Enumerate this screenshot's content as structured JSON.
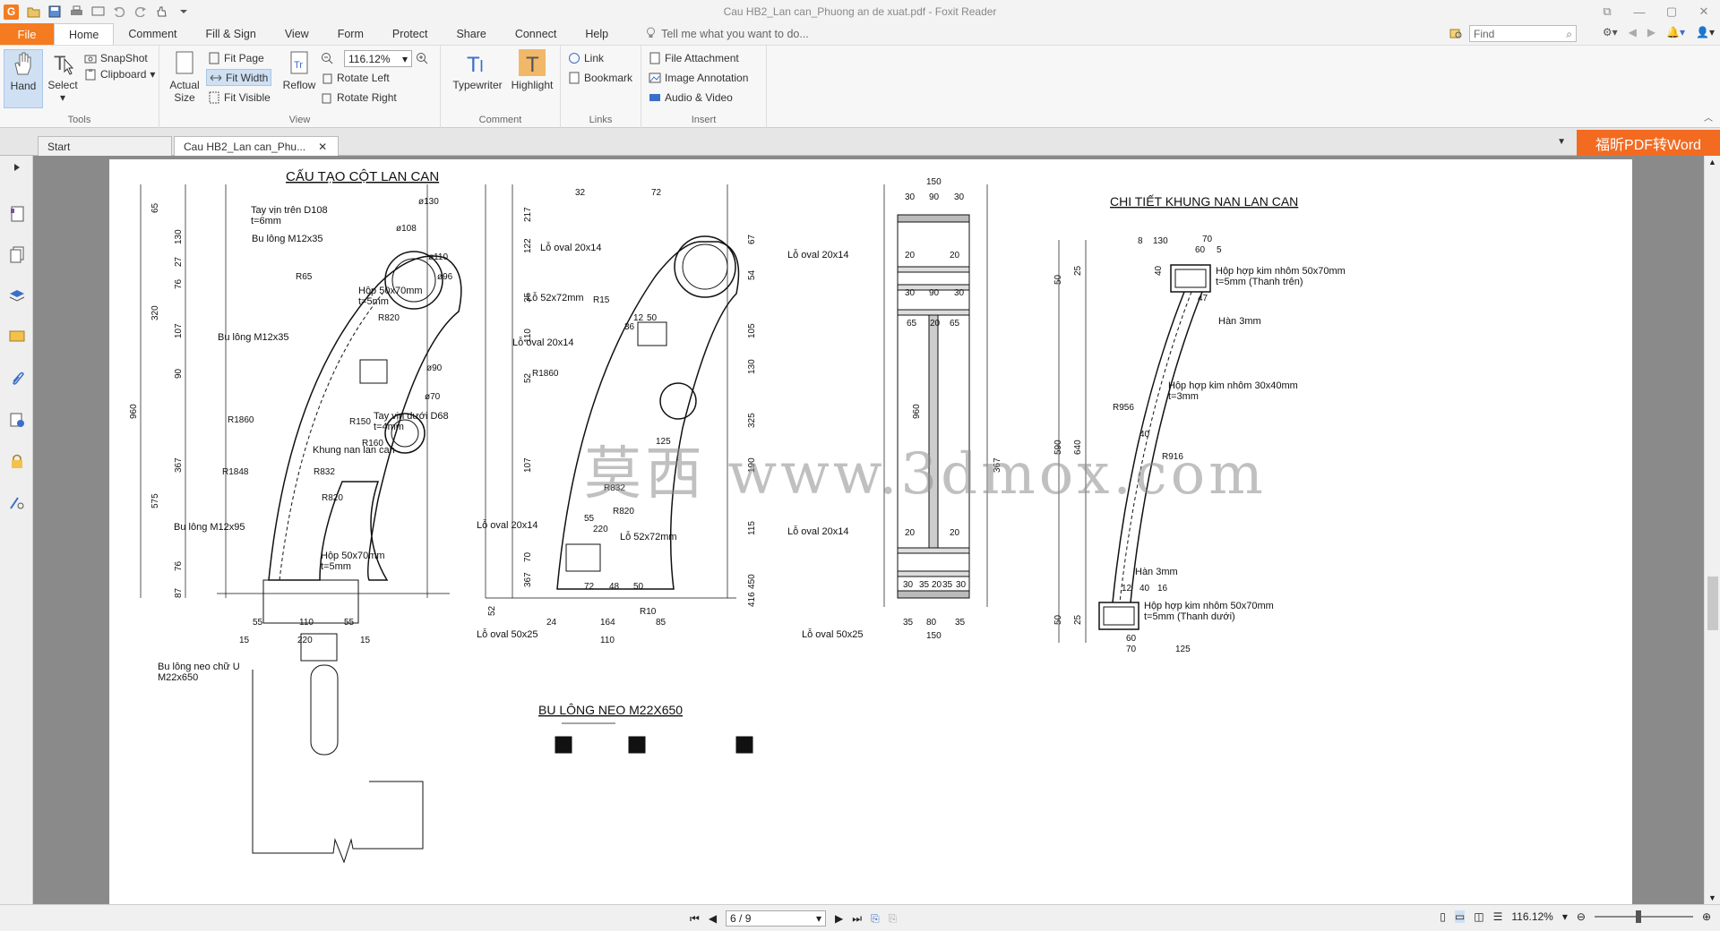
{
  "window": {
    "title": "Cau HB2_Lan can_Phuong an de xuat.pdf - Foxit Reader",
    "app_icon": "G",
    "buttons": [
      "restore-icon",
      "minimize-icon",
      "maximize-icon",
      "close-icon"
    ]
  },
  "menu": {
    "file": "File",
    "items": [
      "Home",
      "Comment",
      "Fill & Sign",
      "View",
      "Form",
      "Protect",
      "Share",
      "Connect",
      "Help"
    ],
    "active": "Home",
    "tell_me": "Tell me what you want to do...",
    "find_placeholder": "Find"
  },
  "ribbon": {
    "tools": {
      "label": "Tools",
      "hand": "Hand",
      "select": "Select",
      "snapshot": "SnapShot",
      "clipboard": "Clipboard"
    },
    "view": {
      "label": "View",
      "actual_size_1": "Actual",
      "actual_size_2": "Size",
      "fit_page": "Fit Page",
      "fit_width": "Fit Width",
      "fit_visible": "Fit Visible",
      "reflow": "Reflow",
      "zoom": "116.12%",
      "rotate_left": "Rotate Left",
      "rotate_right": "Rotate Right"
    },
    "comment": {
      "label": "Comment",
      "typewriter": "Typewriter",
      "highlight": "Highlight"
    },
    "links": {
      "label": "Links",
      "link": "Link",
      "bookmark": "Bookmark"
    },
    "insert": {
      "label": "Insert",
      "file_attachment": "File Attachment",
      "image_annotation": "Image Annotation",
      "audio_video": "Audio & Video"
    }
  },
  "tabs": {
    "start": "Start",
    "doc": "Cau HB2_Lan can_Phu...",
    "promo": "福昕PDF转Word"
  },
  "drawing": {
    "title_left": "CẤU TẠO CỘT LAN CAN",
    "title_right": "CHI TIẾT KHUNG NAN LAN CAN",
    "title_bottom": "BU LÔNG NEO M22X650",
    "labels": {
      "tay_vin_tren": "Tay vịn trên D108",
      "t6": "t=6mm",
      "bu_long_1": "Bu lông M12x35",
      "bu_long_2": "Bu lông M12x35",
      "hop_1": "Hộp 50x70mm",
      "t5": "t=5mm",
      "tay_vin_duoi": "Tay vịn dưới D68",
      "t4": "t=4mm",
      "khung": "Khung nan lan can",
      "bu_long_95": "Bu lông M12x95",
      "hop_2": "Hộp 50x70mm",
      "t5b": "t=5mm",
      "bu_long_neo": "Bu lông neo chữ U",
      "m22": "M22x650",
      "lo_oval_1": "Lỗ oval 20x14",
      "lo_52": "Lỗ 52x72mm",
      "lo_oval_2": "Lỗ oval 20x14",
      "lo_oval_3": "Lỗ oval 20x14",
      "lo_52b": "Lỗ 52x72mm",
      "lo_oval_50": "Lỗ oval 50x25",
      "lo_oval_4": "Lỗ oval 20x14",
      "lo_oval_5": "Lỗ oval 20x14",
      "lo_oval_50b": "Lỗ oval 50x25",
      "hop_top": "Hộp hợp kim nhôm 50x70mm",
      "top_t": "t=5mm (Thanh trên)",
      "han_1": "Hàn 3mm",
      "hop_mid": "Hộp hợp kim nhôm 30x40mm",
      "mid_t": "t=3mm",
      "han_2": "Hàn 3mm",
      "hop_bot": "Hộp hợp kim nhôm 50x70mm",
      "bot_t": "t=5mm (Thanh dưới)"
    },
    "dims_left": [
      "65",
      "130",
      "27",
      "76",
      "320",
      "107",
      "90",
      "960",
      "575",
      "367",
      "76",
      "87",
      "55",
      "110",
      "55",
      "220",
      "15",
      "15"
    ],
    "dims_mid": [
      "217",
      "122",
      "35",
      "110",
      "52",
      "107",
      "70",
      "367",
      "52",
      "67",
      "54",
      "105",
      "130",
      "325",
      "190",
      "115",
      "450",
      "416",
      "125",
      "24",
      "164",
      "85",
      "110",
      "55",
      "220",
      "72",
      "48",
      "50",
      "12",
      "50",
      "36",
      "32",
      "72"
    ],
    "dims_col3": [
      "150",
      "30",
      "90",
      "30",
      "20",
      "20",
      "30",
      "90",
      "30",
      "65",
      "20",
      "65",
      "960",
      "367",
      "20",
      "20",
      "30",
      "35",
      "20",
      "35",
      "30",
      "35",
      "80",
      "35",
      "150"
    ],
    "dims_right": [
      "8",
      "130",
      "70",
      "60",
      "5",
      "25",
      "50",
      "40",
      "47",
      "R956",
      "R916",
      "40",
      "590",
      "640",
      "12",
      "40",
      "16",
      "50",
      "25",
      "60",
      "70",
      "125"
    ],
    "radii": [
      "ø130",
      "ø108",
      "ø110",
      "ø96",
      "R65",
      "R820",
      "R1860",
      "R1848",
      "R832",
      "R820",
      "ø90",
      "ø70",
      "R150",
      "R160",
      "R1860",
      "R832",
      "R820",
      "R10",
      "R15"
    ],
    "watermark": "莫西 www.3dmox.com"
  },
  "status": {
    "page": "6 / 9",
    "zoom": "116.12%"
  }
}
